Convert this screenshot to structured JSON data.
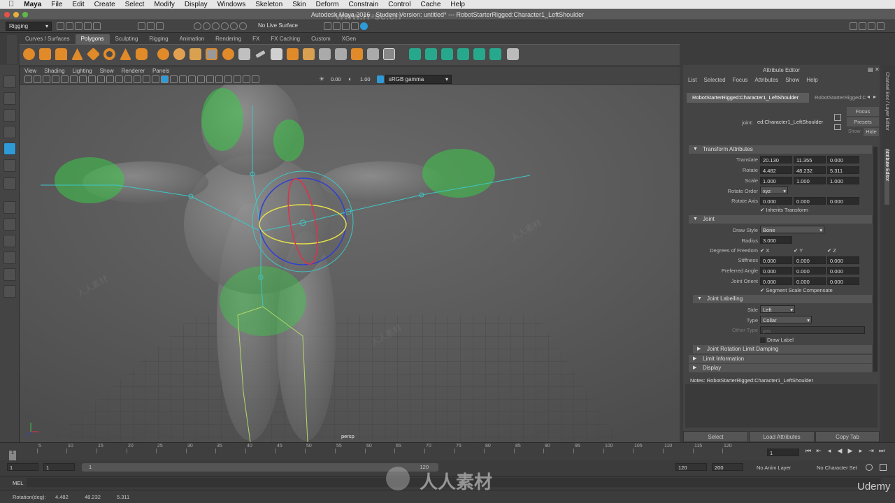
{
  "menubar": {
    "apple": "",
    "app": "Maya",
    "items": [
      "File",
      "Edit",
      "Create",
      "Select",
      "Modify",
      "Display",
      "Windows",
      "Skeleton",
      "Skin",
      "Deform",
      "Constrain",
      "Control",
      "Cache",
      "Help"
    ]
  },
  "window": {
    "title": "Autodesk Maya 2016 - Student Version: untitled*   ---   RobotStarterRigged:Character1_LeftShoulder"
  },
  "statusline": {
    "menuset": "Rigging",
    "live_surface": "No Live Surface"
  },
  "shelf": {
    "tabs": [
      "Curves / Surfaces",
      "Polygons",
      "Sculpting",
      "Rigging",
      "Animation",
      "Rendering",
      "FX",
      "FX Caching",
      "Custom",
      "XGen"
    ],
    "active": "Polygons"
  },
  "panel": {
    "menus": [
      "View",
      "Shading",
      "Lighting",
      "Show",
      "Renderer",
      "Panels"
    ],
    "exposure": "0.00",
    "gamma": "1.00",
    "color_space": "sRGB gamma",
    "camera_label": "persp"
  },
  "attribute_editor": {
    "title": "Attribute Editor",
    "menu": [
      "List",
      "Selected",
      "Focus",
      "Attributes",
      "Show",
      "Help"
    ],
    "tabs": [
      "RobotStarterRigged:Character1_LeftShoulder",
      "RobotStarterRigged:C"
    ],
    "joint_label": "joint:",
    "joint_value": "ed:Character1_LeftShoulder",
    "focus_btn": "Focus",
    "presets_btn": "Presets",
    "show_label": "Show",
    "hide_btn": "Hide",
    "transform": {
      "header": "Transform Attributes",
      "translate_label": "Translate",
      "translate": [
        "20.130",
        "11.355",
        "0.000"
      ],
      "rotate_label": "Rotate",
      "rotate": [
        "4.482",
        "48.232",
        "5.311"
      ],
      "scale_label": "Scale",
      "scale": [
        "1.000",
        "1.000",
        "1.000"
      ],
      "rotate_order_label": "Rotate Order",
      "rotate_order": "xyz",
      "rotate_axis_label": "Rotate Axis",
      "rotate_axis": [
        "0.000",
        "0.000",
        "0.000"
      ],
      "inherits": "Inherits Transform"
    },
    "joint": {
      "header": "Joint",
      "draw_style_label": "Draw Style",
      "draw_style": "Bone",
      "radius_label": "Radius",
      "radius": "3.000",
      "dof_label": "Degrees of Freedom",
      "dof": [
        "X",
        "Y",
        "Z"
      ],
      "stiffness_label": "Stiffness",
      "stiffness": [
        "0.000",
        "0.000",
        "0.000"
      ],
      "pref_angle_label": "Preferred Angle",
      "pref_angle": [
        "0.000",
        "0.000",
        "0.000"
      ],
      "orient_label": "Joint Orient",
      "orient": [
        "0.000",
        "0.000",
        "0.000"
      ],
      "ssc": "Segment Scale Compensate"
    },
    "labelling": {
      "header": "Joint Labelling",
      "side_label": "Side",
      "side": "Left",
      "type_label": "Type",
      "type": "Collar",
      "other_type_label": "Other Type",
      "other_type": "jaw",
      "draw_label": "Draw Label"
    },
    "collapsed": [
      "Joint Rotation Limit Damping",
      "Limit Information",
      "Display"
    ],
    "notes": "Notes:  RobotStarterRigged:Character1_LeftShoulder",
    "buttons": [
      "Select",
      "Load Attributes",
      "Copy Tab"
    ]
  },
  "sidebar": {
    "tabs": [
      "Channel Box / Layer Editor",
      "Attribute Editor"
    ]
  },
  "timeline": {
    "ticks": [
      "5",
      "10",
      "15",
      "20",
      "25",
      "30",
      "35",
      "40",
      "45",
      "50",
      "55",
      "60",
      "65",
      "70",
      "75",
      "80",
      "85",
      "90",
      "95",
      "100",
      "105",
      "110",
      "115",
      "120"
    ],
    "current": "1",
    "current_field": "1"
  },
  "range": {
    "start": "1",
    "play_start": "1",
    "slider_start": "1",
    "slider_end": "120",
    "play_end": "120",
    "end": "200",
    "anim_layer": "No Anim Layer",
    "char_set": "No Character Set"
  },
  "cmd": {
    "label": "MEL"
  },
  "help": {
    "rotation_label": "Rotation(deg):",
    "rotation": [
      "4.482",
      "48.232",
      "5.311"
    ]
  },
  "watermarks": {
    "top": "www.rr-sc.cn",
    "center": "人人素材",
    "brand": "Udemy"
  },
  "colors": {
    "accent": "#2e9bd6",
    "joint_cyan": "#3fc6c6",
    "skin_green": "#3cc84a",
    "gizmo_yellow": "#e6e04a",
    "gizmo_red": "#e0304a",
    "gizmo_blue": "#3040d0"
  }
}
